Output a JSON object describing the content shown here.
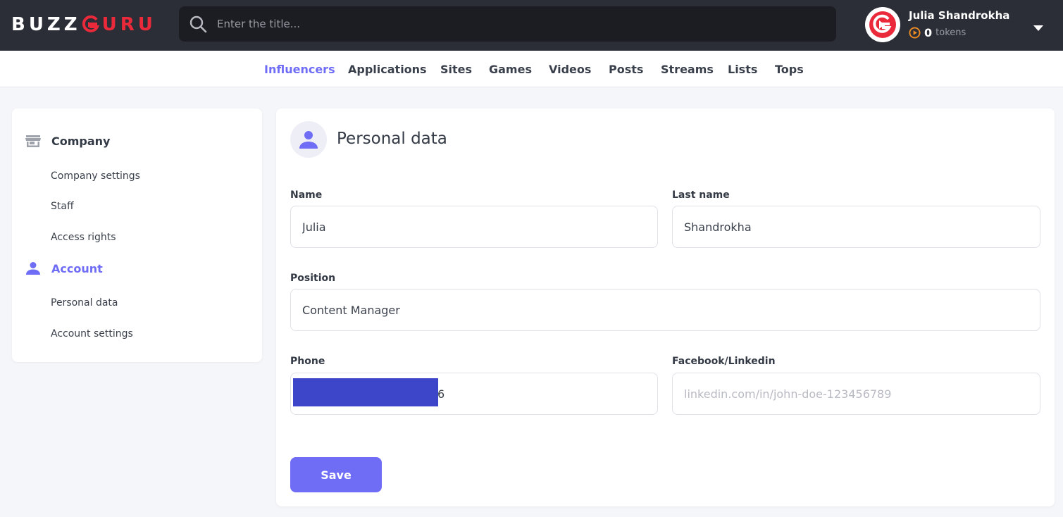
{
  "header": {
    "logo_part1": "BUZZ",
    "logo_part2": "URU",
    "search_placeholder": "Enter the title...",
    "user_name": "Julia Shandrokha",
    "token_count": "0",
    "token_label": "tokens"
  },
  "nav": {
    "items": [
      "Influencers",
      "Applications",
      "Sites",
      "Games",
      "Videos",
      "Posts",
      "Streams",
      "Lists",
      "Tops"
    ],
    "active": "Influencers"
  },
  "sidebar": {
    "company_label": "Company",
    "company_links": [
      "Company settings",
      "Staff",
      "Access rights"
    ],
    "account_label": "Account",
    "account_links": [
      "Personal data",
      "Account settings"
    ]
  },
  "form": {
    "title": "Personal data",
    "name_label": "Name",
    "name_value": "Julia",
    "last_name_label": "Last name",
    "last_name_value": "Shandrokha",
    "position_label": "Position",
    "position_value": "Content Manager",
    "phone_label": "Phone",
    "phone_visible_tail": "6",
    "social_label": "Facebook/Linkedin",
    "social_placeholder": "linkedin.com/in/john-doe-123456789",
    "save_label": "Save"
  },
  "colors": {
    "accent": "#6f6cf6",
    "header_bg": "#2b2e36",
    "brand_red": "#ea2a3b",
    "token_orange": "#f08c21",
    "redaction": "#3d46c8"
  }
}
